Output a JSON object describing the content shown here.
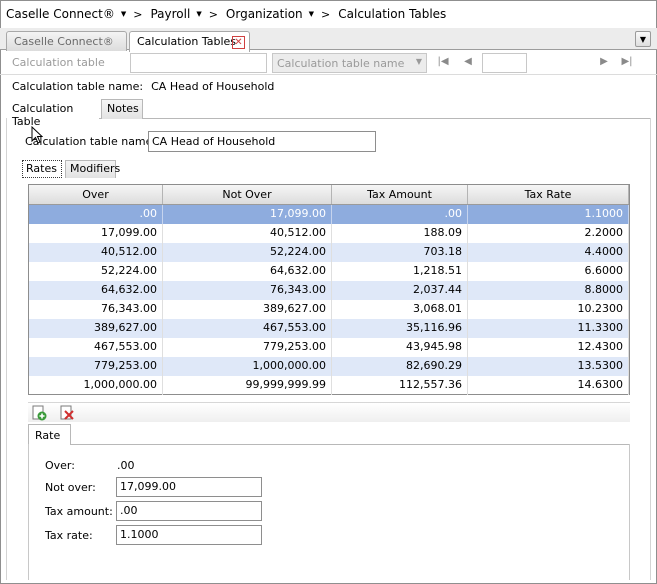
{
  "breadcrumb": [
    "Caselle Connect®",
    "Payroll",
    "Organization",
    "Calculation Tables"
  ],
  "doc_tabs": {
    "inactive": "Caselle Connect®",
    "active": "Calculation Tables"
  },
  "toolbar": {
    "label": "Calculation table",
    "select_placeholder": "Calculation table name"
  },
  "header": {
    "name_label": "Calculation table name:",
    "name_value": "CA Head of Household"
  },
  "sub_tabs": [
    "Calculation Table",
    "Notes"
  ],
  "form": {
    "name_label": "Calculation table name:",
    "name_value": "CA Head of Household"
  },
  "inner_tabs": [
    "Rates",
    "Modifiers"
  ],
  "grid": {
    "columns": [
      "Over",
      "Not Over",
      "Tax Amount",
      "Tax Rate"
    ],
    "rows": [
      [
        ".00",
        "17,099.00",
        ".00",
        "1.1000"
      ],
      [
        "17,099.00",
        "40,512.00",
        "188.09",
        "2.2000"
      ],
      [
        "40,512.00",
        "52,224.00",
        "703.18",
        "4.4000"
      ],
      [
        "52,224.00",
        "64,632.00",
        "1,218.51",
        "6.6000"
      ],
      [
        "64,632.00",
        "76,343.00",
        "2,037.44",
        "8.8000"
      ],
      [
        "76,343.00",
        "389,627.00",
        "3,068.01",
        "10.2300"
      ],
      [
        "389,627.00",
        "467,553.00",
        "35,116.96",
        "11.3300"
      ],
      [
        "467,553.00",
        "779,253.00",
        "43,945.98",
        "12.4300"
      ],
      [
        "779,253.00",
        "1,000,000.00",
        "82,690.29",
        "13.5300"
      ],
      [
        "1,000,000.00",
        "99,999,999.99",
        "112,557.36",
        "14.6300"
      ]
    ]
  },
  "rate_panel": {
    "tab": "Rate",
    "over_label": "Over:",
    "over_value": ".00",
    "not_over_label": "Not over:",
    "not_over_value": "17,099.00",
    "tax_amount_label": "Tax amount:",
    "tax_amount_value": ".00",
    "tax_rate_label": "Tax rate:",
    "tax_rate_value": "1.1000"
  },
  "icons": {
    "add": "add-row-icon",
    "delete": "delete-row-icon"
  }
}
